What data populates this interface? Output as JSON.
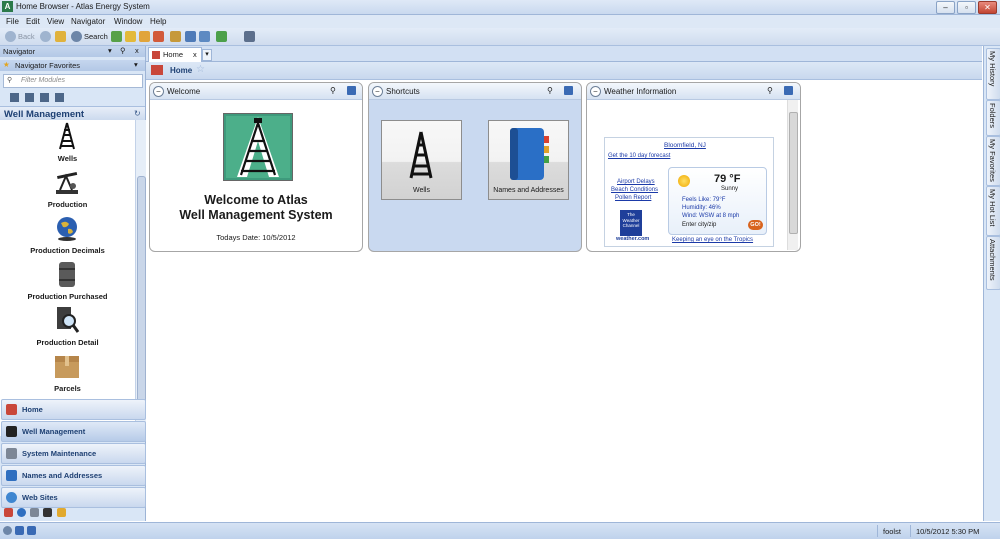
{
  "window": {
    "title": "Home Browser - Atlas Energy System",
    "app_icon": "A"
  },
  "menu": [
    "File",
    "Edit",
    "View",
    "Navigator",
    "Window",
    "Help"
  ],
  "toolbar": {
    "back_label": "Back",
    "search_label": "Search"
  },
  "navigator": {
    "title": "Navigator",
    "favorites_label": "Navigator Favorites",
    "filter_placeholder": "Filter Modules",
    "section_title": "Well Management",
    "modules": [
      {
        "label": "Wells",
        "icon": "oil-derrick-icon"
      },
      {
        "label": "Production",
        "icon": "pump-jack-icon"
      },
      {
        "label": "Production Decimals",
        "icon": "globe-icon"
      },
      {
        "label": "Production Purchased",
        "icon": "barrel-icon"
      },
      {
        "label": "Production Detail",
        "icon": "magnifier-icon"
      },
      {
        "label": "Parcels",
        "icon": "box-icon"
      }
    ],
    "nav_buttons": [
      "Home",
      "Well Management",
      "System Maintenance",
      "Names and Addresses",
      "Web Sites"
    ]
  },
  "tabs": [
    {
      "label": "Home",
      "close": "x"
    }
  ],
  "breadcrumb": {
    "label": "Home"
  },
  "panels": {
    "welcome": {
      "title": "Welcome",
      "heading_line1": "Welcome to Atlas",
      "heading_line2": "Well Management System",
      "date_text": "Todays Date: 10/5/2012"
    },
    "shortcuts": {
      "title": "Shortcuts",
      "items": [
        {
          "label": "Wells"
        },
        {
          "label": "Names and Addresses"
        }
      ]
    },
    "weather": {
      "title": "Weather Information",
      "location": "Bloomfield, NJ",
      "forecast_link": "Get the 10 day forecast",
      "links": [
        "Airport Delays",
        "Beach Conditions",
        "Pollen Report"
      ],
      "temperature": "79 °F",
      "condition": "Sunny",
      "feels_like": "Feels Like: 79°F",
      "humidity": "Humidity: 46%",
      "wind": "Wind: WSW at 8 mph",
      "zip_placeholder": "Enter city/zip",
      "go_label": "GO!",
      "brand_line1": "The",
      "brand_line2": "Weather",
      "brand_line3": "Channel",
      "brand_site": "weather.com",
      "tropics_link": "Keeping an eye on the Tropics"
    }
  },
  "right_dock": [
    "My History",
    "Folders",
    "My Favorites",
    "My Hot List",
    "Attachments"
  ],
  "status": {
    "user": "foolst",
    "datetime": "10/5/2012   5:30 PM"
  },
  "colors": {
    "accent": "#1d3f72",
    "brand_green": "#2b7a4b",
    "link": "#1b3aa8"
  }
}
